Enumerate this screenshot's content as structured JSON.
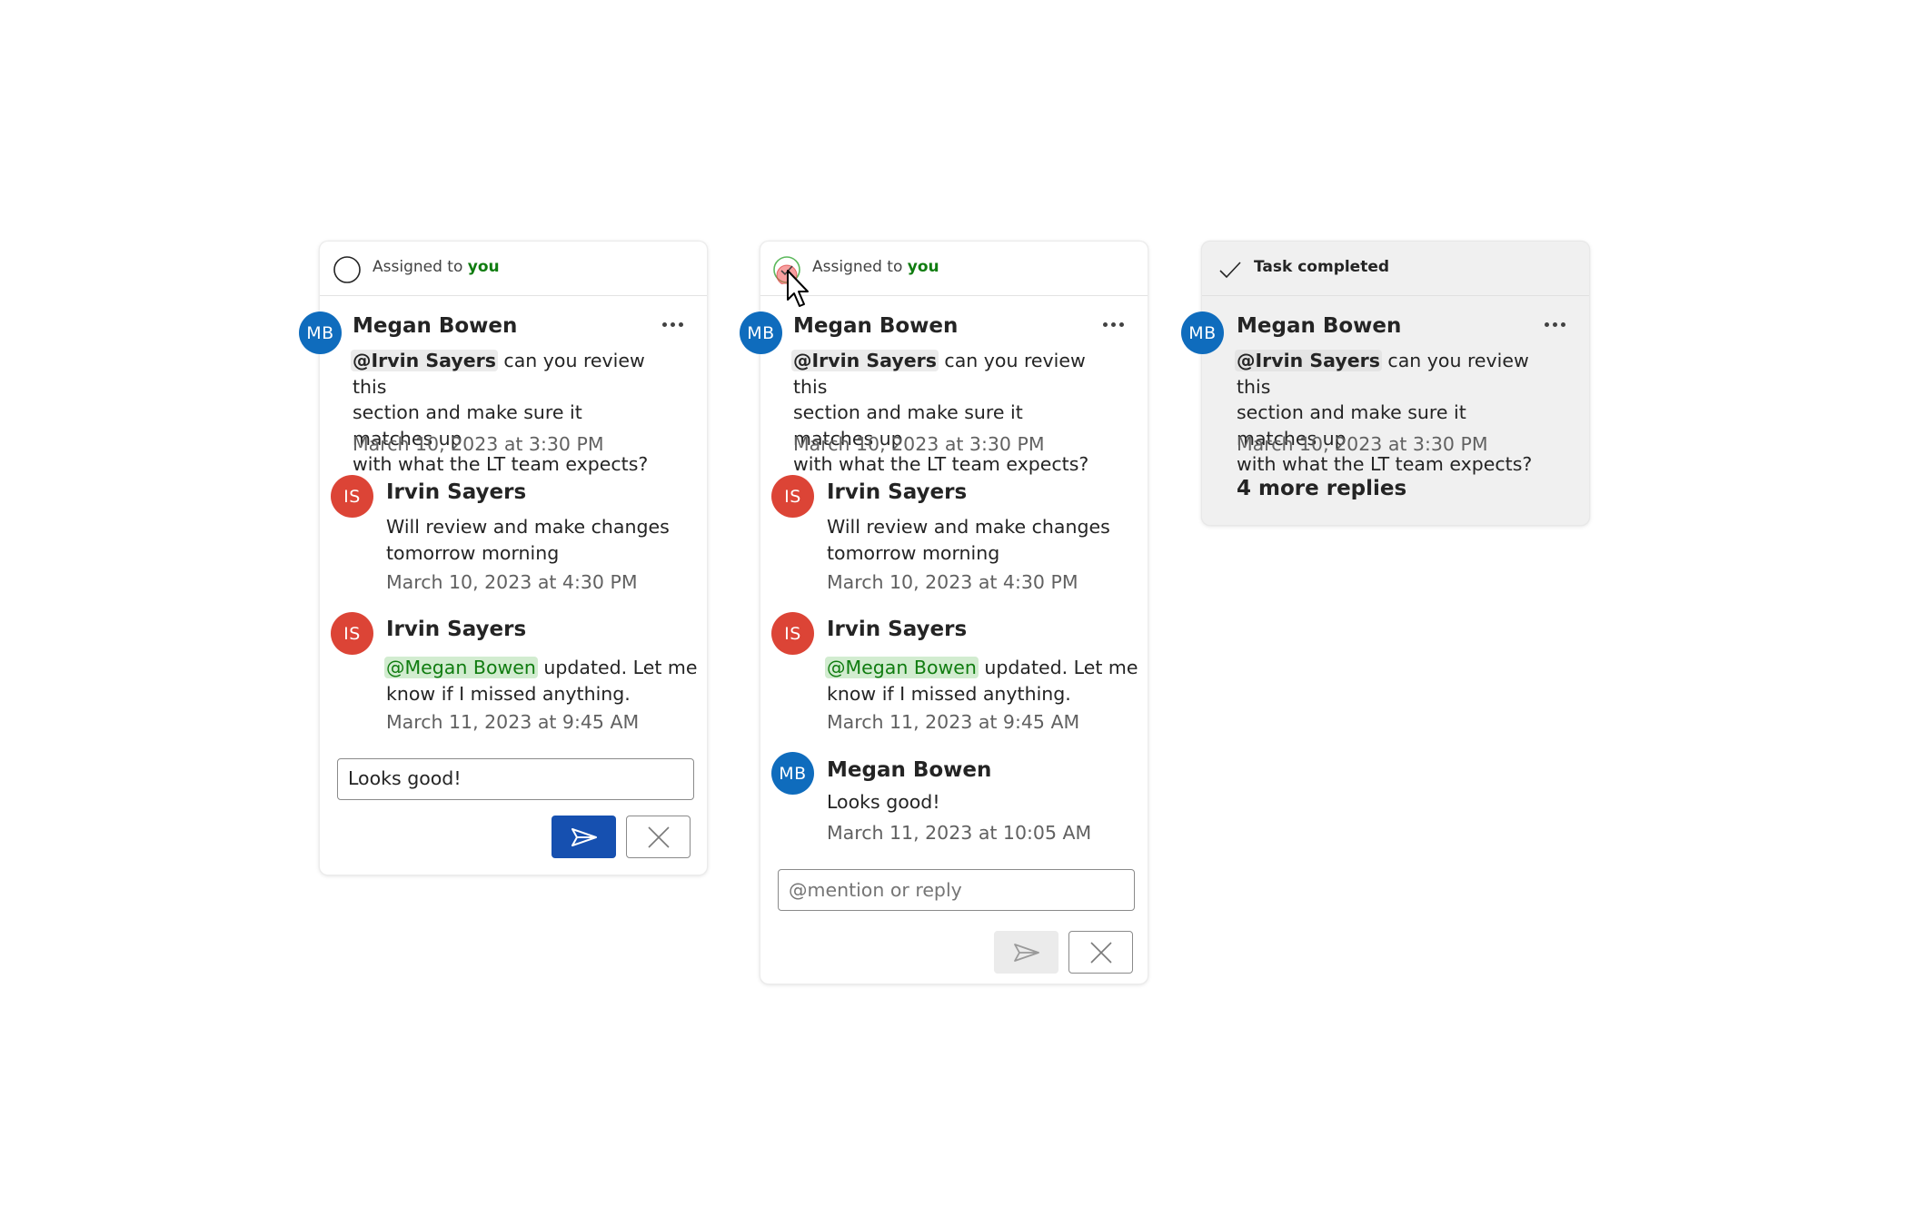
{
  "cards": [
    {
      "state": "open",
      "header": {
        "prefix": "Assigned to ",
        "highlight": "you",
        "icon": "empty-circle-icon"
      },
      "thread": [
        {
          "initials": "MB",
          "author": "Megan Bowen",
          "mention": "@Irvin Sayers",
          "text_lines": [
            " can you review this",
            "section and make sure it matches up",
            "with what the LT team expects?"
          ],
          "timestamp": "March 10, 2023 at 3:30 PM"
        },
        {
          "initials": "IS",
          "author": "Irvin Sayers",
          "text_lines": [
            "Will review and make changes",
            "tomorrow morning"
          ],
          "timestamp": "March 10, 2023 at 4:30 PM"
        },
        {
          "initials": "IS",
          "author": "Irvin Sayers",
          "mention": "@Megan Bowen",
          "text_lines": [
            " updated. Let me",
            "know if I missed anything."
          ],
          "timestamp": "March 11, 2023 at 9:45 AM"
        }
      ],
      "reply_input": {
        "value": "Looks good!",
        "placeholder": "@mention or reply"
      },
      "send_label": "Send",
      "cancel_label": "Cancel"
    },
    {
      "state": "completing",
      "header": {
        "prefix": "Assigned to ",
        "highlight": "you",
        "icon": "check-circle-icon"
      },
      "thread": [
        {
          "initials": "MB",
          "author": "Megan Bowen",
          "mention": "@Irvin Sayers",
          "text_lines": [
            " can you review this",
            "section and make sure it matches up",
            "with what the LT team expects?"
          ],
          "timestamp": "March 10, 2023 at 3:30 PM"
        },
        {
          "initials": "IS",
          "author": "Irvin Sayers",
          "text_lines": [
            "Will review and make changes",
            "tomorrow morning"
          ],
          "timestamp": "March 10, 2023 at 4:30 PM"
        },
        {
          "initials": "IS",
          "author": "Irvin Sayers",
          "mention": "@Megan Bowen",
          "text_lines": [
            " updated. Let me",
            "know if I missed anything."
          ],
          "timestamp": "March 11, 2023 at 9:45 AM"
        },
        {
          "initials": "MB",
          "author": "Megan Bowen",
          "text_lines": [
            "Looks good!"
          ],
          "timestamp": "March 11, 2023 at 10:05 AM"
        }
      ],
      "reply_input": {
        "value": "",
        "placeholder": "@mention or reply"
      },
      "send_label": "Send",
      "cancel_label": "Cancel"
    },
    {
      "state": "completed",
      "header": {
        "label": "Task completed",
        "icon": "checkmark-icon"
      },
      "thread": [
        {
          "initials": "MB",
          "author": "Megan Bowen",
          "mention": "@Irvin Sayers",
          "text_lines": [
            " can you review this",
            "section and make sure it matches up",
            "with what the LT team expects?"
          ],
          "timestamp": "March 10, 2023 at 3:30 PM"
        }
      ],
      "more_replies": "4 more replies"
    }
  ],
  "colors": {
    "accent_blue": "#1650b0",
    "avatar_mb": "#0f6cbd",
    "avatar_is": "#dc4436",
    "you_green": "#107c10",
    "mention_green_bg": "#d2ecd0"
  }
}
